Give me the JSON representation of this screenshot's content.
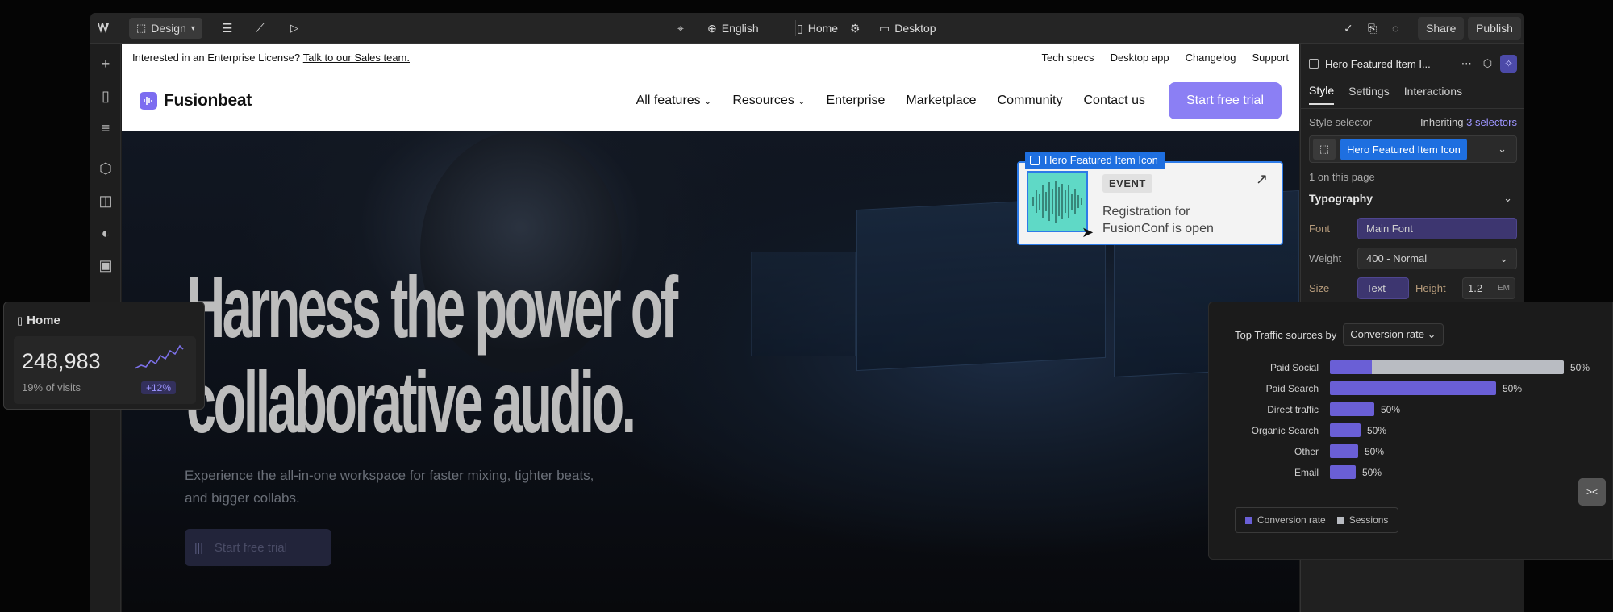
{
  "toolbar": {
    "mode": "Design",
    "locale": "English",
    "page": "Home",
    "breakpoint": "Desktop",
    "share": "Share",
    "publish": "Publish"
  },
  "site": {
    "banner_text": "Interested in an Enterprise License?",
    "banner_link": "Talk to our Sales team.",
    "banner_links": [
      "Tech specs",
      "Desktop app",
      "Changelog",
      "Support"
    ],
    "brand": "Fusionbeat",
    "nav": [
      "All features",
      "Resources",
      "Enterprise",
      "Marketplace",
      "Community",
      "Contact us"
    ],
    "cta": "Start free trial",
    "headline_1": "Harness the power of",
    "headline_2": "collaborative audio.",
    "subtext": "Experience the all-in-one workspace for faster mixing, tighter beats, and bigger collabs.",
    "hero_cta": "Start free trial"
  },
  "selection": {
    "label": "Hero Featured Item Icon",
    "badge": "EVENT",
    "card_text": "Registration for FusionConf is open"
  },
  "panel": {
    "element": "Hero Featured Item I...",
    "tabs": [
      "Style",
      "Settings",
      "Interactions"
    ],
    "style_selector": "Style selector",
    "inheriting": "Inheriting",
    "selectors": "3 selectors",
    "selector_chip": "Hero Featured Item Icon",
    "on_page": "1 on this page",
    "typography": "Typography",
    "font_label": "Font",
    "font_value": "Main Font",
    "weight_label": "Weight",
    "weight_value": "400 - Normal",
    "size_label": "Size",
    "size_value": "Text",
    "height_label": "Height",
    "height_value": "1.2",
    "height_unit": "EM"
  },
  "home_card": {
    "title": "Home",
    "value": "248,983",
    "caption": "19% of visits",
    "delta": "+12%"
  },
  "traffic": {
    "heading": "Top Traffic sources by",
    "metric": "Conversion rate",
    "legend": [
      "Conversion rate",
      "Sessions"
    ],
    "colors": {
      "conversion": "#6a5fd6",
      "sessions": "#b9bcc2"
    }
  },
  "chart_data": {
    "type": "bar",
    "categories": [
      "Paid Social",
      "Paid Search",
      "Direct traffic",
      "Organic Search",
      "Other",
      "Email"
    ],
    "series": [
      {
        "name": "Conversion rate",
        "values": [
          50,
          50,
          50,
          50,
          50,
          50
        ]
      }
    ],
    "bar_fractions": [
      1.0,
      0.71,
      0.19,
      0.13,
      0.12,
      0.11
    ],
    "value_labels": [
      "50%",
      "50%",
      "50%",
      "50%",
      "50%",
      "50%"
    ],
    "legend": [
      "Conversion rate",
      "Sessions"
    ]
  }
}
